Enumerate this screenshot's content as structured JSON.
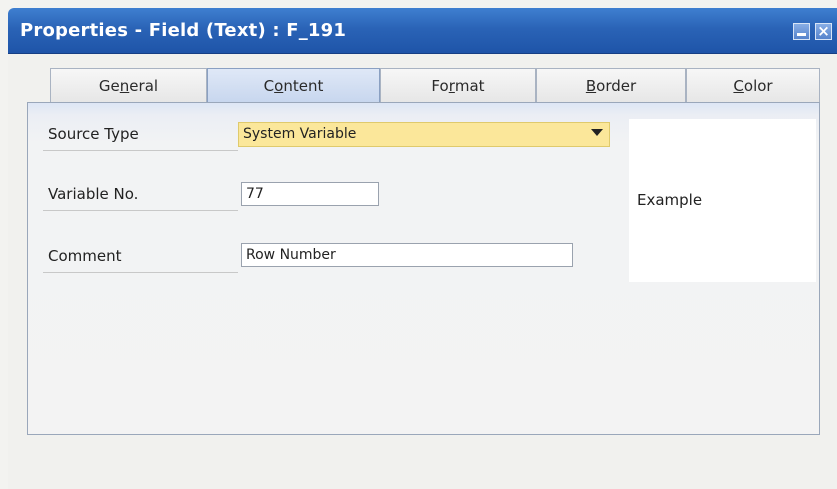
{
  "window": {
    "title": "Properties - Field (Text) : F_191"
  },
  "tabs": [
    {
      "label": "General",
      "pre": "Ge",
      "key": "n",
      "post": "eral",
      "active": false
    },
    {
      "label": "Content",
      "pre": "C",
      "key": "o",
      "post": "ntent",
      "active": true
    },
    {
      "label": "Format",
      "pre": "Fo",
      "key": "r",
      "post": "mat",
      "active": false
    },
    {
      "label": "Border",
      "pre": "",
      "key": "B",
      "post": "order",
      "active": false
    },
    {
      "label": "Color",
      "pre": "",
      "key": "C",
      "post": "olor",
      "active": false
    }
  ],
  "form": {
    "source_type_label": "Source Type",
    "source_type_value": "System Variable",
    "variable_no_label": "Variable No.",
    "variable_no_value": "77",
    "comment_label": "Comment",
    "comment_value": "Row Number"
  },
  "example": {
    "text": "Example"
  },
  "colors": {
    "title_bar": "#2a63b6",
    "dropdown_bg": "#fbe79a",
    "active_tab": "#c7d6ee"
  }
}
